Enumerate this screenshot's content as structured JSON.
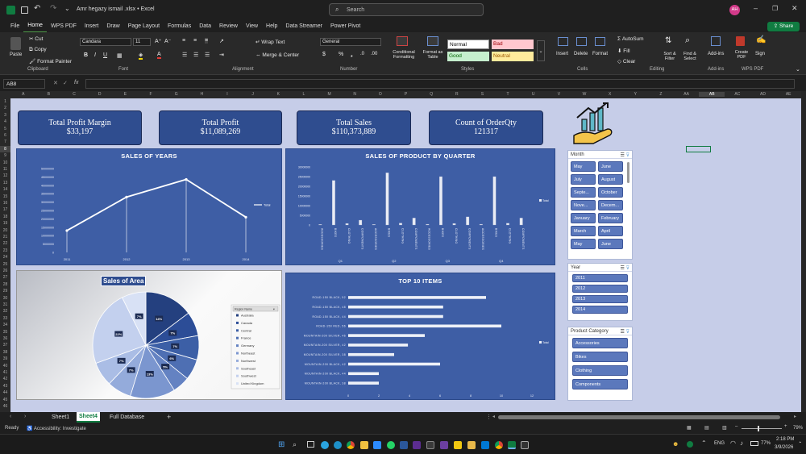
{
  "titlebar": {
    "filename": "Amr hegazy ismail .xlsx",
    "app": "Excel",
    "search_placeholder": "Search",
    "user_initials": "AH"
  },
  "menu": [
    "File",
    "Home",
    "WPS PDF",
    "Insert",
    "Draw",
    "Page Layout",
    "Formulas",
    "Data",
    "Review",
    "View",
    "Help",
    "Data Streamer",
    "Power Pivot"
  ],
  "share_label": "Share",
  "ribbon": {
    "paste": "Paste",
    "cut": "Cut",
    "copy": "Copy",
    "format_painter": "Format Painter",
    "clipboard": "Clipboard",
    "font_name": "Candara",
    "font_size": "11",
    "font": "Font",
    "wrap_text": "Wrap Text",
    "merge_center": "Merge & Center",
    "alignment": "Alignment",
    "number_format": "General",
    "number": "Number",
    "conditional": "Conditional Formatting",
    "format_table": "Format as Table",
    "styles": {
      "normal": "Normal",
      "bad": "Bad",
      "good": "Good",
      "neutral": "Neutral"
    },
    "styles_label": "Styles",
    "insert": "Insert",
    "delete": "Delete",
    "format": "Format",
    "cells": "Cells",
    "autosum": "AutoSum",
    "fill": "Fill",
    "clear": "Clear",
    "sort_filter": "Sort & Filter",
    "find_select": "Find & Select",
    "editing": "Editing",
    "addins": "Add-ins",
    "addins_label": "Add-ins",
    "create_pdf": "Create PDF",
    "sign": "Sign",
    "wps_pdf": "WPS PDF"
  },
  "formula_bar": {
    "name_box": "AB8",
    "fx": "fx",
    "value": ""
  },
  "columns": [
    "A",
    "B",
    "C",
    "D",
    "E",
    "F",
    "G",
    "H",
    "I",
    "J",
    "K",
    "L",
    "M",
    "N",
    "O",
    "P",
    "Q",
    "R",
    "S",
    "T",
    "U",
    "V",
    "W",
    "X",
    "Y",
    "Z",
    "AA",
    "AB",
    "AC",
    "AD",
    "AE"
  ],
  "kpis": [
    {
      "title": "Total Profit Margin",
      "value": "$33,197"
    },
    {
      "title": "Total Profit",
      "value": "$11,089,269"
    },
    {
      "title": "Total Sales",
      "value": "$110,373,889"
    },
    {
      "title": "Count of OrderQty",
      "value": "121317"
    }
  ],
  "chart_data": [
    {
      "type": "line",
      "title": "SALES OF YEARS",
      "x": [
        "2011",
        "2012",
        "2013",
        "2014"
      ],
      "series": [
        {
          "name": "Total",
          "values": [
            13000000,
            33000000,
            43500000,
            21000000
          ]
        }
      ],
      "ylim": [
        0,
        50000000
      ],
      "yticks": [
        "0",
        "5000000",
        "10000000",
        "15000000",
        "20000000",
        "25000000",
        "30000000",
        "35000000",
        "40000000",
        "45000000",
        "50000000"
      ]
    },
    {
      "type": "bar",
      "title": "SALES OF PRODUCT BY QUARTER",
      "quarters": [
        "Q1",
        "Q2",
        "Q3",
        "Q4"
      ],
      "categories": [
        "ACCESSORIES",
        "BIKES",
        "CLOTHING",
        "COMPONENTS"
      ],
      "series": [
        {
          "name": "Total",
          "values": [
            300000,
            23000000,
            800000,
            2500000,
            300000,
            27000000,
            1000000,
            3600000,
            400000,
            25000000,
            800000,
            4200000,
            400000,
            25000000,
            900000,
            3600000
          ]
        }
      ],
      "ylim": [
        0,
        30000000
      ],
      "yticks": [
        "0",
        "5000000",
        "10000000",
        "15000000",
        "20000000",
        "25000000",
        "30000000"
      ]
    },
    {
      "type": "pie",
      "title": "Sales of Area",
      "legend_title": "Region Name",
      "categories": [
        "Australia",
        "Canada",
        "Central",
        "France",
        "Germany",
        "Northeast",
        "Northwest",
        "Southeast",
        "Southwest",
        "United Kingdom"
      ],
      "values": [
        14,
        7,
        7,
        6,
        5,
        13,
        7,
        7,
        22,
        7
      ],
      "labels": [
        "14%",
        "7%",
        "7%",
        "6%",
        "5%",
        "13%",
        "7%",
        "7%",
        "22%",
        "7%"
      ]
    },
    {
      "type": "bar",
      "title": "TOP 10 ITEMS",
      "orientation": "horizontal",
      "categories": [
        "ROAD-150 BLACK, 52",
        "ROAD-150 BLACK, 48",
        "ROAD-150 BLACK, 44",
        "ROAD-150 RED, 56",
        "MOUNTAIN-200 SILVER, 46",
        "MOUNTAIN-200 SILVER, 42",
        "MOUNTAIN-200 SILVER, 38",
        "MOUNTAIN-200 BLACK, 42",
        "MOUNTAIN-200 BLACK, 44",
        "MOUNTAIN-200 BLACK, 38"
      ],
      "series": [
        {
          "name": "Total",
          "values": [
            9.0,
            6.2,
            6.2,
            10.0,
            5.0,
            3.9,
            3.0,
            6.0,
            2.0,
            2.0
          ]
        }
      ],
      "xlim": [
        0,
        12
      ],
      "xticks": [
        "0",
        "2",
        "4",
        "6",
        "8",
        "10",
        "12"
      ]
    }
  ],
  "slicers": {
    "month": {
      "title": "Month",
      "items": [
        "May",
        "June",
        "July",
        "August",
        "Septe...",
        "October",
        "Nove...",
        "Decem...",
        "January",
        "February",
        "March",
        "April",
        "May",
        "June"
      ]
    },
    "year": {
      "title": "Year",
      "items": [
        "2011",
        "2012",
        "2013",
        "2014"
      ]
    },
    "category": {
      "title": "Product Category",
      "items": [
        "Accessories",
        "Bikes",
        "Clothing",
        "Components"
      ]
    }
  },
  "sheet_tabs": [
    "Sheet1",
    "Sheet4",
    "Full Database"
  ],
  "active_tab": "Sheet4",
  "status": {
    "ready": "Ready",
    "accessibility": "Accessibility: Investigate",
    "zoom": "79%"
  },
  "taskbar": {
    "lang": "ENG",
    "battery": "77%",
    "time": "2:18 PM",
    "date": "3/9/2026"
  },
  "colors": {
    "panel": "#3e5ea5",
    "kpi": "#2f4d8f",
    "sheet_bg": "#c6cde8",
    "excel_green": "#107c41"
  }
}
